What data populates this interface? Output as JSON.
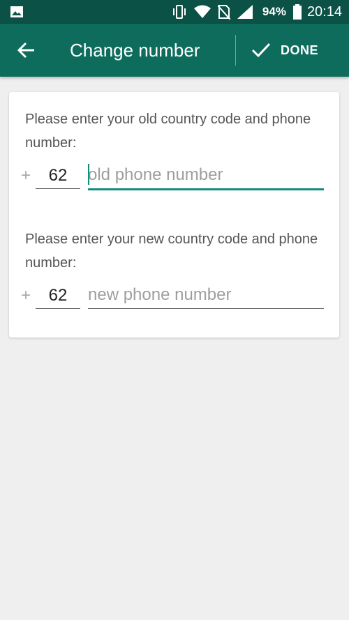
{
  "status_bar": {
    "battery": "94%",
    "time": "20:14",
    "icons": [
      "gallery-icon",
      "vibrate-icon",
      "wifi-icon",
      "no-sim-icon",
      "signal-icon",
      "battery-icon"
    ]
  },
  "app_bar": {
    "title": "Change number",
    "done_label": "DONE"
  },
  "old_number": {
    "prompt": "Please enter your old country code and phone number:",
    "plus": "+",
    "country_code": "62",
    "placeholder": "old phone number"
  },
  "new_number": {
    "prompt": "Please enter your new country code and phone number:",
    "plus": "+",
    "country_code": "62",
    "placeholder": "new phone number"
  },
  "colors": {
    "status_bar": "#0b5146",
    "app_bar": "#0e6c5d",
    "accent": "#128c7e",
    "background": "#efefef"
  }
}
